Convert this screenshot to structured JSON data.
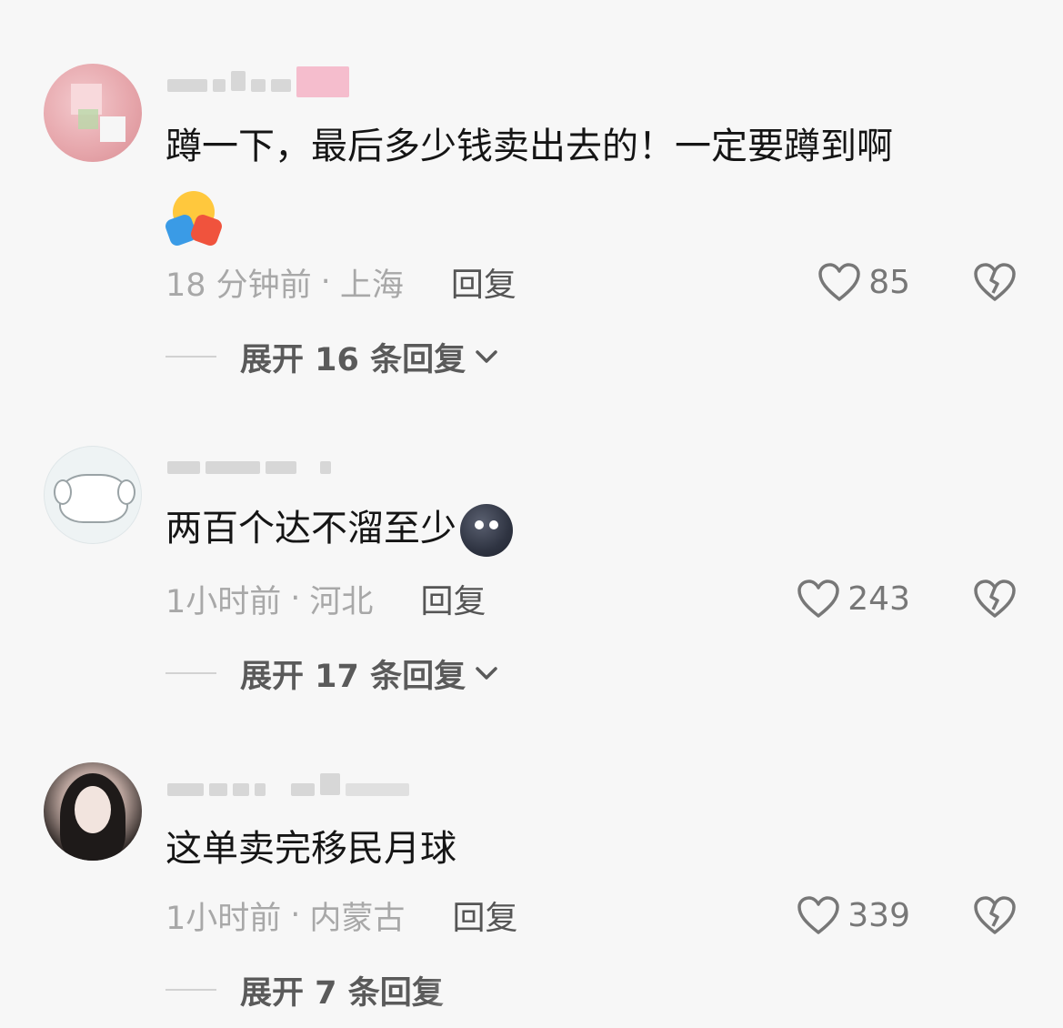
{
  "comments": [
    {
      "content": "蹲一下，最后多少钱卖出去的！一定要蹲到啊",
      "emoji": "hugging-face-emoji",
      "time": "18 分钟前",
      "sep": "·",
      "location": "上海",
      "reply_label": "回复",
      "likes": "85",
      "expand_label": "展开 16 条回复"
    },
    {
      "content": "两百个达不溜至少",
      "emoji": "new-moon-face-emoji",
      "time": "1小时前",
      "sep": "·",
      "location": "河北",
      "reply_label": "回复",
      "likes": "243",
      "expand_label": "展开 17 条回复"
    },
    {
      "content": "这单卖完移民月球",
      "time": "1小时前",
      "sep": "·",
      "location": "内蒙古",
      "reply_label": "回复",
      "likes": "339",
      "expand_label": "展开 7 条回复"
    }
  ],
  "icons": {
    "like": "heart-outline-icon",
    "dislike": "broken-heart-icon",
    "expand": "chevron-down-icon"
  },
  "colors": {
    "background": "#f7f7f7",
    "text": "#151515",
    "meta": "#a8a8a8",
    "reply": "#555555"
  }
}
